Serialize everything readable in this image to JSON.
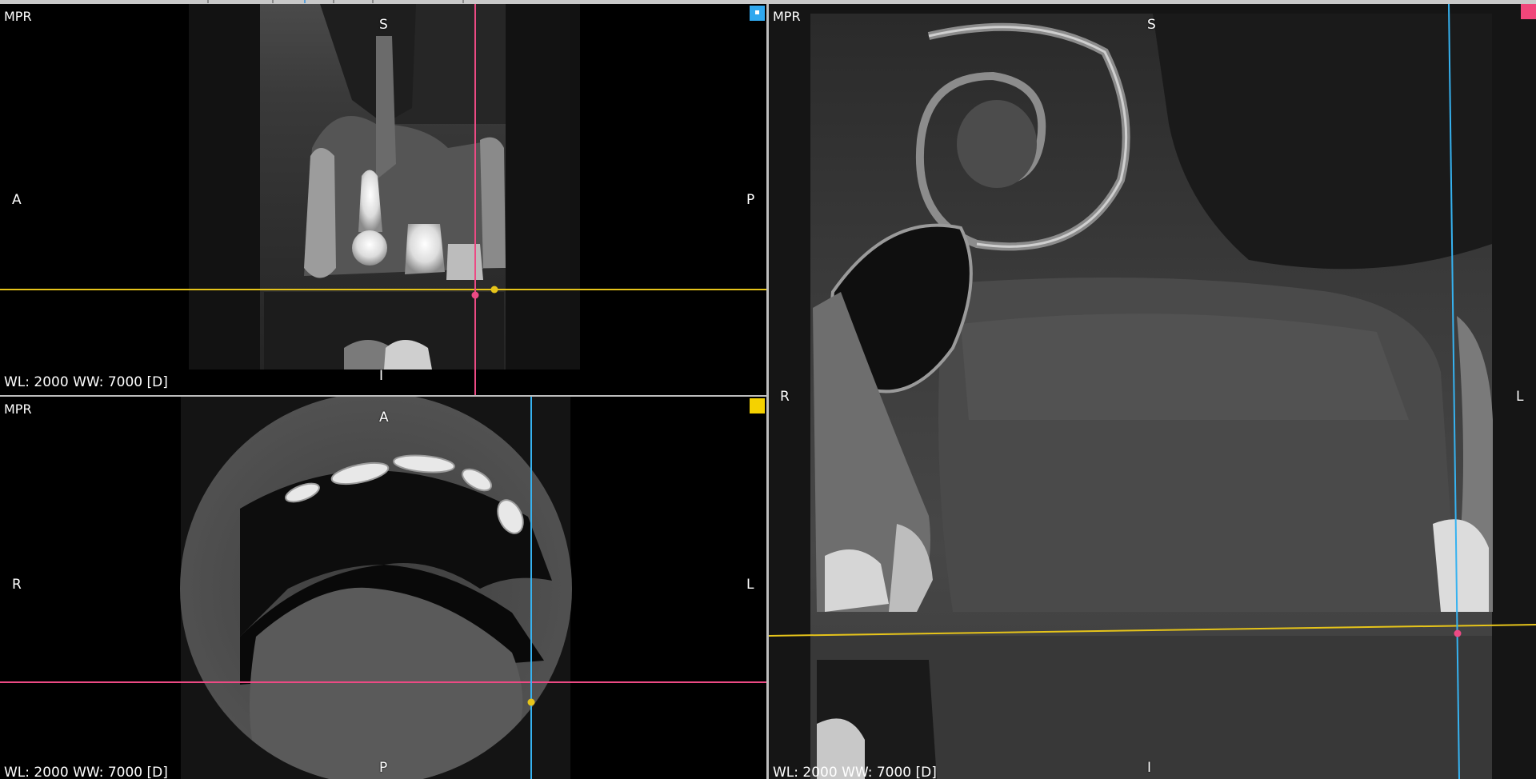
{
  "viewports": {
    "sagittal": {
      "mode_label": "MPR",
      "orientation": {
        "top": "S",
        "bottom": "I",
        "left": "A",
        "right": "P"
      },
      "window_level": "WL: 2000 WW: 7000 [D]",
      "marker_color": "#2fa8ef"
    },
    "axial": {
      "mode_label": "MPR",
      "orientation": {
        "top": "A",
        "bottom": "P",
        "left": "R",
        "right": "L"
      },
      "window_level": "WL: 2000 WW: 7000 [D]",
      "marker_color": "#f5d200"
    },
    "coronal": {
      "mode_label": "MPR",
      "orientation": {
        "top": "S",
        "bottom": "I",
        "left": "R",
        "right": "L"
      },
      "window_level": "WL: 2000 WW: 7000 [D]",
      "marker_color": "#f0467a"
    }
  },
  "crosshair_colors": {
    "axial_plane": "#e6c41a",
    "sagittal_plane": "#ec4a84",
    "coronal_plane": "#36b2f0"
  }
}
